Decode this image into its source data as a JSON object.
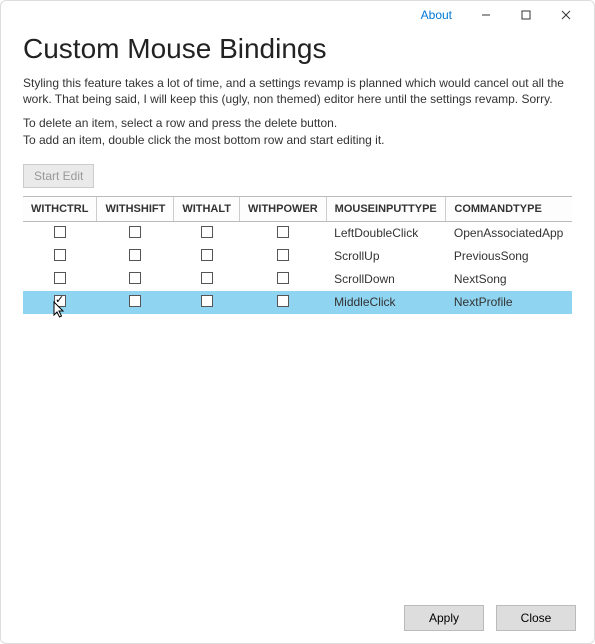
{
  "titlebar": {
    "about_label": "About"
  },
  "page": {
    "title": "Custom Mouse Bindings",
    "desc1": "Styling this feature takes a lot of time, and a settings revamp is planned which would cancel out all the work. That being said, I will keep this (ugly, non themed) editor here until the settings revamp. Sorry.",
    "desc2": "To delete an item, select a row and press the delete button.",
    "desc3": "To add an item, double click the most bottom row and start editing it.",
    "start_edit_label": "Start Edit"
  },
  "grid": {
    "headers": {
      "withctrl": "WITHCTRL",
      "withshift": "WITHSHIFT",
      "withalt": "WITHALT",
      "withpower": "WITHPOWER",
      "mouseinput": "MOUSEINPUTTYPE",
      "commandtype": "COMMANDTYPE"
    },
    "rows": [
      {
        "withctrl": false,
        "withshift": false,
        "withalt": false,
        "withpower": false,
        "mouseinput": "LeftDoubleClick",
        "commandtype": "OpenAssociatedApp",
        "selected": false
      },
      {
        "withctrl": false,
        "withshift": false,
        "withalt": false,
        "withpower": false,
        "mouseinput": "ScrollUp",
        "commandtype": "PreviousSong",
        "selected": false
      },
      {
        "withctrl": false,
        "withshift": false,
        "withalt": false,
        "withpower": false,
        "mouseinput": "ScrollDown",
        "commandtype": "NextSong",
        "selected": false
      },
      {
        "withctrl": true,
        "withshift": false,
        "withalt": false,
        "withpower": false,
        "mouseinput": "MiddleClick",
        "commandtype": "NextProfile",
        "selected": true
      }
    ]
  },
  "footer": {
    "apply_label": "Apply",
    "close_label": "Close"
  }
}
